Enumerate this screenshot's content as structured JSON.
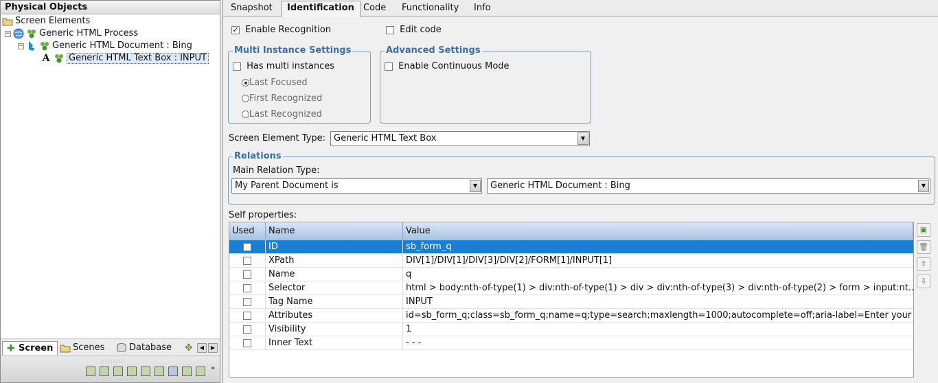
{
  "left_panel": {
    "title": "Physical Objects",
    "tree": [
      {
        "label": "Screen Elements"
      },
      {
        "label": "Generic HTML Process"
      },
      {
        "label": "Generic HTML Document : Bing"
      },
      {
        "label": "Generic HTML Text Box : INPUT"
      }
    ],
    "bottom_tabs": [
      {
        "label": "Screen"
      },
      {
        "label": "Scenes"
      },
      {
        "label": "Database"
      }
    ]
  },
  "tabs": [
    "Snapshot",
    "Identification",
    "Code",
    "Functionality",
    "Info"
  ],
  "identification": {
    "enable_recognition": "Enable Recognition",
    "edit_code": "Edit code",
    "multi_instance": {
      "title": "Multi Instance Settings",
      "has_multi": "Has multi instances",
      "options": [
        "Last Focused",
        "First Recognized",
        "Last Recognized"
      ]
    },
    "advanced": {
      "title": "Advanced Settings",
      "continuous": "Enable Continuous Mode"
    },
    "screen_element_type_label": "Screen Element Type:",
    "screen_element_type_value": "Generic HTML Text Box",
    "relations": {
      "title": "Relations",
      "main_relation_label": "Main Relation Type:",
      "relation_type": "My Parent Document is",
      "relation_target": "Generic HTML Document : Bing"
    },
    "self_properties_label": "Self properties:",
    "columns": [
      "Used",
      "Name",
      "Value"
    ],
    "rows": [
      {
        "used": true,
        "name": "ID",
        "value": "sb_form_q"
      },
      {
        "used": false,
        "name": "XPath",
        "value": "DIV[1]/DIV[1]/DIV[3]/DIV[2]/FORM[1]/INPUT[1]"
      },
      {
        "used": false,
        "name": "Name",
        "value": "q"
      },
      {
        "used": false,
        "name": "Selector",
        "value": "html > body:nth-of-type(1) > div:nth-of-type(1) > div > div:nth-of-type(3) > div:nth-of-type(2) > form > input:nt..."
      },
      {
        "used": false,
        "name": "Tag Name",
        "value": "INPUT"
      },
      {
        "used": false,
        "name": "Attributes",
        "value": "id=sb_form_q;class=sb_form_q;name=q;type=search;maxlength=1000;autocomplete=off;aria-label=Enter your se..."
      },
      {
        "used": false,
        "name": "Visibility",
        "value": "1"
      },
      {
        "used": false,
        "name": "Inner Text",
        "value": "- - -"
      }
    ]
  },
  "colors": {
    "accent": "#1a7fd4",
    "group_title": "#3d6fa8"
  }
}
